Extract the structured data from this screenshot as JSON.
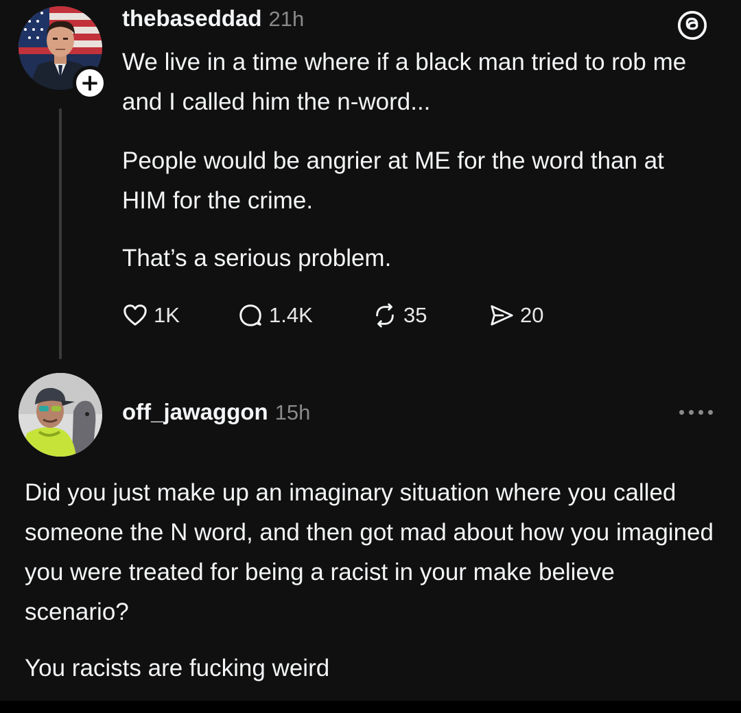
{
  "post": {
    "username": "thebaseddad",
    "time": "21h",
    "paragraphs": [
      "We live in a time where if a black man tried to rob me and I called him the n-word...",
      "People would be angrier at ME for the word than at HIM for the crime.",
      "That’s a serious problem."
    ],
    "actions": {
      "likes": "1K",
      "replies": "1.4K",
      "reposts": "35",
      "shares": "20"
    }
  },
  "reply": {
    "username": "off_jawaggon",
    "time": "15h",
    "paragraphs": [
      "Did you just make up an imaginary situation where you called someone the N word, and then got mad about how you imagined you were treated for being a racist in your make believe scenario?",
      "You racists are fucking weird"
    ]
  },
  "icons": {
    "app_logo": "threads-logo-icon",
    "like": "heart-icon",
    "reply": "comment-icon",
    "repost": "repost-icon",
    "share": "share-icon",
    "more": "more-icon",
    "follow": "plus-icon"
  },
  "colors": {
    "background": "#101010",
    "text": "#f3f5f7",
    "secondary": "#8a8a8a"
  }
}
